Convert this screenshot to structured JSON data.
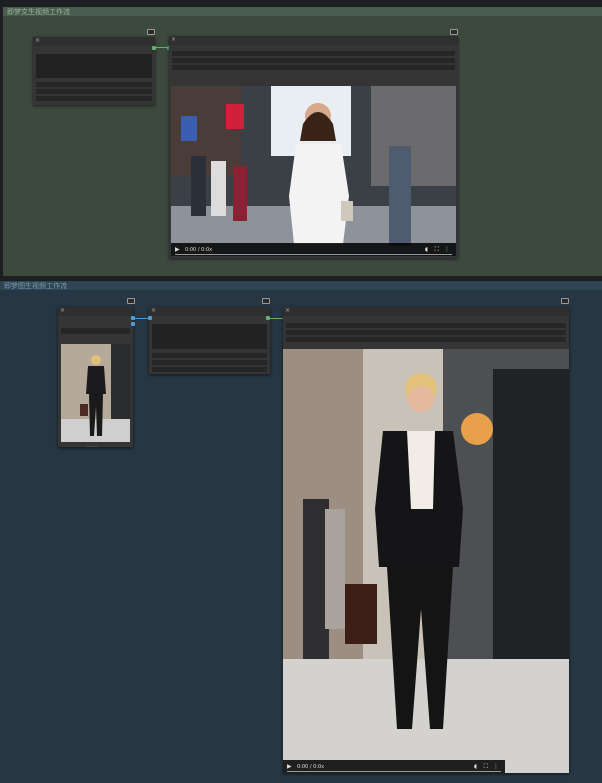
{
  "groups": [
    {
      "title": "即梦文生视频工作流",
      "color": "#3c4a3e",
      "header_color": "#4a5c4d"
    },
    {
      "title": "即梦图生视频工作流",
      "color": "#263642",
      "header_color": "#2f4554"
    }
  ],
  "video_player": {
    "time_label": "0:00 / 0:0x",
    "play_icon": "play-icon",
    "volume_icon": "volume-icon",
    "fullscreen_icon": "fullscreen-icon",
    "menu_icon": "more-vert-icon"
  },
  "thumbnail_caption": "———",
  "colors": {
    "link_green": "#5fb36a",
    "link_blue": "#4d9ed6",
    "node_bg": "#353535",
    "canvas_bg": "#1e1f22"
  }
}
